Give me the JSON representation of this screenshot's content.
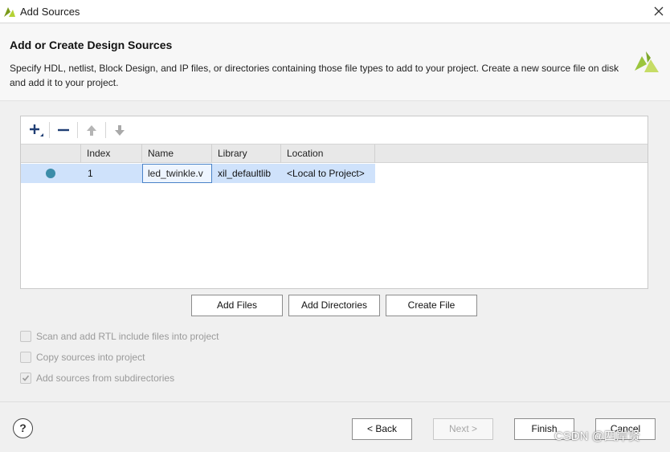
{
  "window": {
    "title": "Add Sources"
  },
  "header": {
    "heading": "Add or Create Design Sources",
    "description": "Specify HDL, netlist, Block Design, and IP files, or directories containing those file types to add to your project. Create a new source file on disk and add it to your project."
  },
  "toolbar": {
    "items": [
      {
        "icon": "plus-icon",
        "enabled": true
      },
      {
        "icon": "minus-icon",
        "enabled": true
      },
      {
        "icon": "arrow-up-icon",
        "enabled": false
      },
      {
        "icon": "arrow-down-icon",
        "enabled": false
      }
    ]
  },
  "table": {
    "columns": [
      "",
      "Index",
      "Name",
      "Library",
      "Location"
    ],
    "rows": [
      {
        "status": "dot",
        "index": "1",
        "name": "led_twinkle.v",
        "library": "xil_defaultlib",
        "location": "<Local to Project>"
      }
    ]
  },
  "actions": {
    "add_files": "Add Files",
    "add_directories": "Add Directories",
    "create_file": "Create File"
  },
  "options": [
    {
      "label": "Scan and add RTL include files into project",
      "checked": false,
      "enabled": false
    },
    {
      "label": "Copy sources into project",
      "checked": false,
      "enabled": false
    },
    {
      "label": "Add sources from subdirectories",
      "checked": true,
      "enabled": false
    }
  ],
  "footer": {
    "help": "?",
    "back": "< Back",
    "next": "Next >",
    "finish": "Finish",
    "cancel": "Cancel"
  },
  "watermark": "CSDN @四岸贤",
  "colors": {
    "selection": "#cfe2fb",
    "status_dot": "#3c8da9",
    "brand": "#9bc53d"
  }
}
